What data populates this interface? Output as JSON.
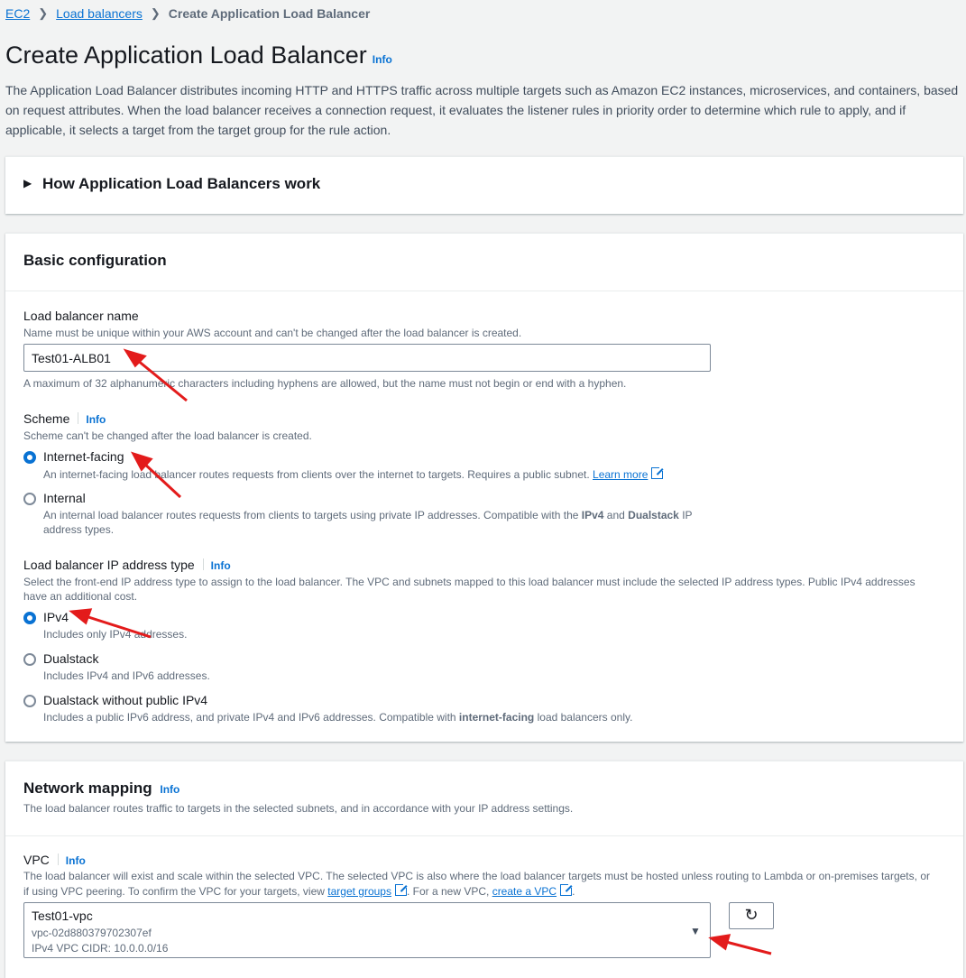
{
  "breadcrumb": {
    "ec2": "EC2",
    "load_balancers": "Load balancers",
    "current": "Create Application Load Balancer"
  },
  "page": {
    "title": "Create Application Load Balancer",
    "info": "Info",
    "description": "The Application Load Balancer distributes incoming HTTP and HTTPS traffic across multiple targets such as Amazon EC2 instances, microservices, and containers, based on request attributes. When the load balancer receives a connection request, it evaluates the listener rules in priority order to determine which rule to apply, and if applicable, it selects a target from the target group for the rule action."
  },
  "expander": {
    "title": "How Application Load Balancers work"
  },
  "basic": {
    "title": "Basic configuration",
    "name_label": "Load balancer name",
    "name_desc": "Name must be unique within your AWS account and can't be changed after the load balancer is created.",
    "name_value": "Test01-ALB01",
    "name_constraint": "A maximum of 32 alphanumeric characters including hyphens are allowed, but the name must not begin or end with a hyphen.",
    "scheme_label": "Scheme",
    "scheme_info": "Info",
    "scheme_desc": "Scheme can't be changed after the load balancer is created.",
    "internet_label": "Internet-facing",
    "internet_desc": "An internet-facing load balancer routes requests from clients over the internet to targets. Requires a public subnet.",
    "learn_more": "Learn more",
    "internal_label": "Internal",
    "internal_desc_1": "An internal load balancer routes requests from clients to targets using private IP addresses. Compatible with the ",
    "internal_desc_b1": "IPv4",
    "internal_desc_2": " and ",
    "internal_desc_b2": "Dualstack",
    "internal_desc_3": " IP",
    "internal_desc_4": "address types.",
    "ip_label": "Load balancer IP address type",
    "ip_info": "Info",
    "ip_desc_1": "Select the front-end IP address type to assign to the load balancer. The VPC and subnets mapped to this load balancer must include the selected IP address types. Public IPv4 addresses",
    "ip_desc_2": "have an additional cost.",
    "ipv4_label": "IPv4",
    "ipv4_desc": "Includes only IPv4 addresses.",
    "dual_label": "Dualstack",
    "dual_desc": "Includes IPv4 and IPv6 addresses.",
    "dualnp_label": "Dualstack without public IPv4",
    "dualnp_desc_1": "Includes a public IPv6 address, and private IPv4 and IPv6 addresses. Compatible with ",
    "dualnp_desc_b": "internet-facing",
    "dualnp_desc_2": " load balancers only."
  },
  "network": {
    "title": "Network mapping",
    "info": "Info",
    "desc": "The load balancer routes traffic to targets in the selected subnets, and in accordance with your IP address settings.",
    "vpc_label": "VPC",
    "vpc_info": "Info",
    "vpc_desc_1": "The load balancer will exist and scale within the selected VPC. The selected VPC is also where the load balancer targets must be hosted unless routing to Lambda or on-premises targets, or",
    "vpc_desc_2": "if using VPC peering. To confirm the VPC for your targets, view ",
    "target_groups": "target groups",
    "vpc_desc_3": ". For a new VPC, ",
    "create_vpc": "create a VPC",
    "vpc_desc_4": ".",
    "vpc_name": "Test01-vpc",
    "vpc_id": "vpc-02d880379702307ef",
    "vpc_cidr": "IPv4 VPC CIDR: 10.0.0.0/16"
  },
  "colors": {
    "link": "#0972d3",
    "annotation_arrow": "#e31b1b"
  }
}
